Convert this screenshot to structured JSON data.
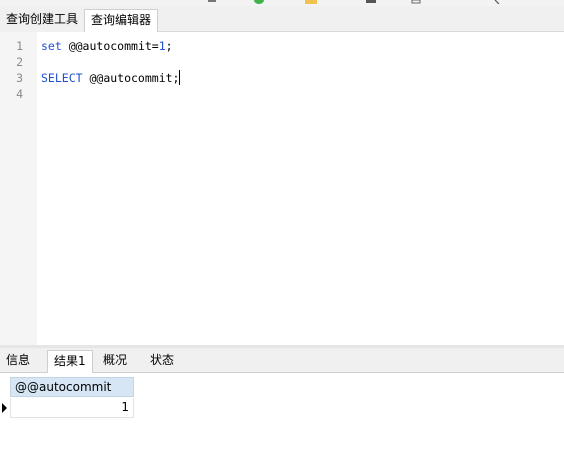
{
  "toolbar": {
    "icon_names": [
      "toolbar-icon-partial",
      "run-green-icon",
      "folder-yellow-icon",
      "save-icon",
      "document-icon",
      "search-icon"
    ]
  },
  "top_tabs": [
    {
      "label": "查询创建工具"
    },
    {
      "label": "查询编辑器"
    }
  ],
  "editor": {
    "line_numbers": [
      "1",
      "2",
      "3",
      "4"
    ],
    "lines": [
      {
        "kw": "set",
        "rest": " @@autocommit=",
        "num": "1",
        "tail": ";"
      },
      {
        "text": ""
      },
      {
        "kw": "SELECT",
        "rest": " @@autocommit;"
      },
      {
        "text": ""
      }
    ]
  },
  "bottom_tabs": [
    {
      "label": "信息"
    },
    {
      "label": "结果1"
    },
    {
      "label": "概况"
    },
    {
      "label": "状态"
    }
  ],
  "result_grid": {
    "columns": [
      "@@autocommit"
    ],
    "rows": [
      [
        "1"
      ]
    ]
  }
}
